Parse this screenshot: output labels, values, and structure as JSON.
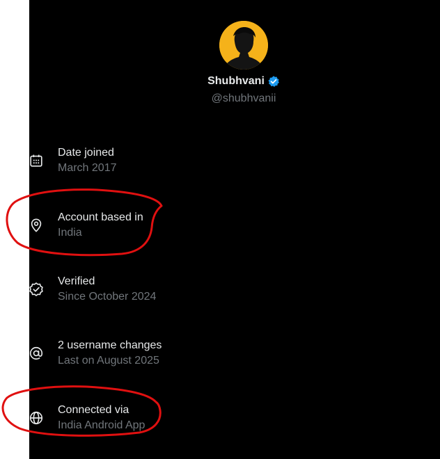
{
  "profile": {
    "display_name": "Shubhvani",
    "handle": "@shubhvanii",
    "verified": true
  },
  "about": {
    "items": [
      {
        "icon": "calendar-icon",
        "title": "Date joined",
        "subtitle": "March 2017"
      },
      {
        "icon": "location-pin-icon",
        "title": "Account based in",
        "subtitle": "India"
      },
      {
        "icon": "verified-badge-icon",
        "title": "Verified",
        "subtitle": "Since October 2024"
      },
      {
        "icon": "at-sign-icon",
        "title": "2 username changes",
        "subtitle": "Last on August 2025"
      },
      {
        "icon": "globe-icon",
        "title": "Connected via",
        "subtitle": "India Android App"
      }
    ]
  },
  "colors": {
    "background": "#000000",
    "text_primary": "#e7e9ea",
    "text_secondary": "#71767b",
    "verified_blue": "#1d9bf0",
    "avatar_bg": "#f5b21a",
    "annotation_red": "#e01010"
  }
}
